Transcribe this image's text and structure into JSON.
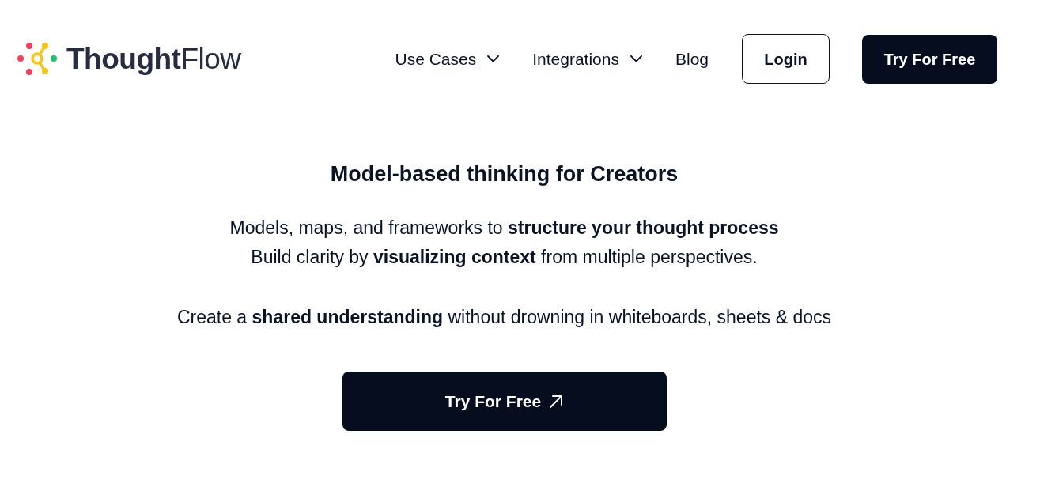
{
  "header": {
    "logo": {
      "text": "**Thought**Flow"
    },
    "nav": [
      {
        "label": "Use Cases",
        "kind": "dropdown"
      },
      {
        "label": "Integrations",
        "kind": "dropdown"
      },
      {
        "label": "Blog",
        "kind": "link"
      }
    ],
    "login_button": "Login",
    "cta_button": "Try For Free"
  },
  "hero": {
    "title": "Model-based thinking for Creators",
    "lines": [
      "Models, maps, and frameworks to **structure your thought process**",
      "Build clarity by **visualizing context** from multiple perspectives."
    ],
    "tagline": "Create a **shared understanding** without drowning in whiteboards, sheets & docs",
    "cta_button": "Try For Free"
  }
}
